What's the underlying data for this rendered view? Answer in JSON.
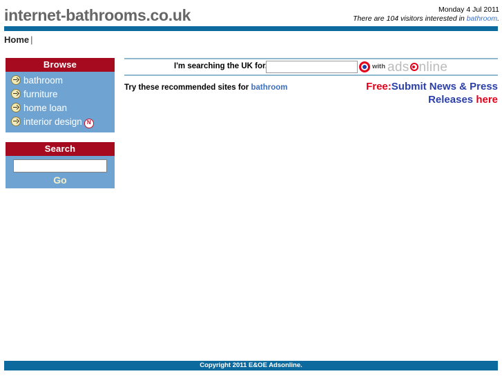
{
  "header": {
    "site_title": "internet-bathrooms.co.uk",
    "date": "Monday 4 Jul 2011",
    "visitors_prefix": "There are 104 visitors interested in ",
    "visitors_keyword": "bathroom",
    "visitors_suffix": ".",
    "visitor_count": "104"
  },
  "nav": {
    "home_label": "Home",
    "separator": "|"
  },
  "sidebar": {
    "browse": {
      "title": "Browse",
      "items": [
        {
          "label": "bathroom",
          "new": false
        },
        {
          "label": "furniture",
          "new": false
        },
        {
          "label": "home loan",
          "new": false
        },
        {
          "label": "interior design",
          "new": true,
          "new_badge": "N"
        }
      ]
    },
    "search": {
      "title": "Search",
      "input_value": "",
      "input_placeholder": "",
      "go_label": "Go"
    }
  },
  "main": {
    "search_prompt": "I'm searching the UK for...",
    "search_input_value": "",
    "search_input_placeholder": "",
    "logo": {
      "with_label": "with",
      "brand_part1": "ads",
      "brand_part2": "nline",
      "brand_full": "adsonline"
    },
    "recommend_prefix": "Try these recommended sites for ",
    "recommend_keyword": "bathroom",
    "promo": {
      "free_label": "Free:",
      "body_label": "Submit News & Press Releases ",
      "here_label": "here"
    }
  },
  "footer": {
    "copyright": "Copyright 2011 E&OE Adsonline."
  },
  "colors": {
    "brand_blue": "#0D6A9E",
    "panel_red": "#A60A1E",
    "panel_blue": "#6FA4D2",
    "link_blue": "#3D6FBF",
    "accent_red": "#E2001A",
    "promo_blue": "#2B3FA8",
    "title_grey": "#666666"
  }
}
